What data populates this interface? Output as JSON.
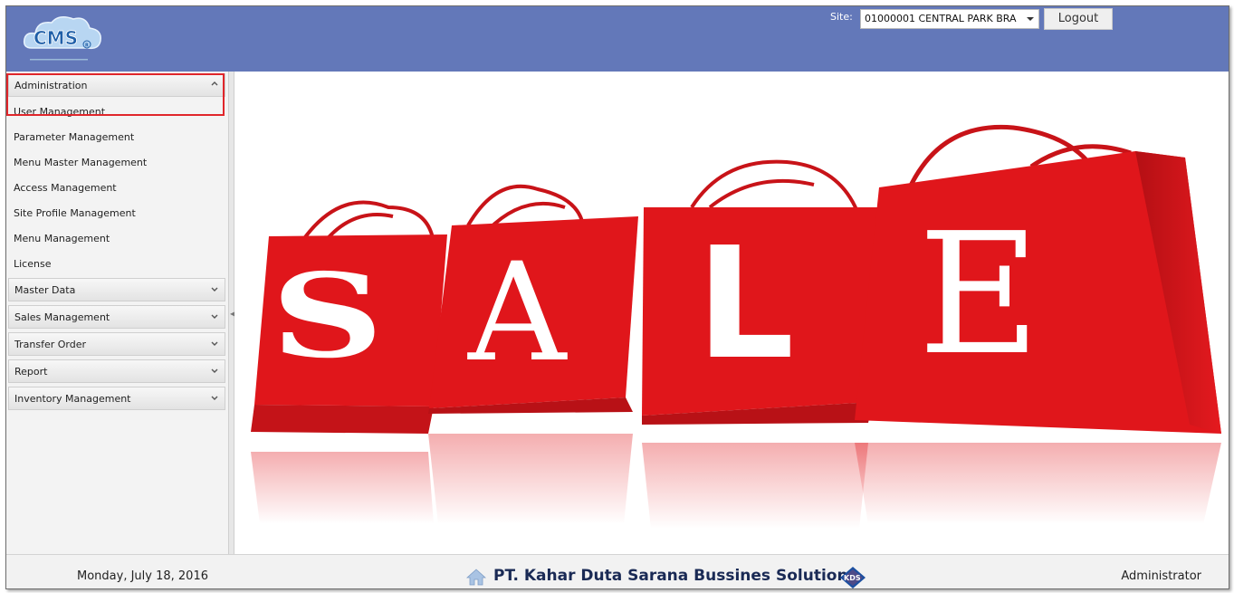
{
  "header": {
    "logo_text": "CMS",
    "logo_registered": "R",
    "site_label": "Site:",
    "site_value": "01000001 CENTRAL PARK BRA",
    "logout_label": "Logout",
    "bg_color": "#6378b9"
  },
  "sidebar": {
    "sections": [
      {
        "label": "Administration",
        "expanded": true,
        "items": [
          "User Management",
          "Parameter Management",
          "Menu Master Management",
          "Access Management",
          "Site Profile Management",
          "Menu Management",
          "License"
        ]
      },
      {
        "label": "Master Data",
        "expanded": false
      },
      {
        "label": "Sales Management",
        "expanded": false
      },
      {
        "label": "Transfer Order",
        "expanded": false
      },
      {
        "label": "Report",
        "expanded": false
      },
      {
        "label": "Inventory Management",
        "expanded": false
      }
    ]
  },
  "banner": {
    "letters": [
      "S",
      "A",
      "L",
      "E"
    ],
    "bag_color": "#e0161b"
  },
  "footer": {
    "date": "Monday, July 18, 2016",
    "company": "PT. Kahar Duta Sarana Bussines Solutions",
    "kds_logo_text": "KDS",
    "user": "Administrator"
  },
  "icons": [
    "cms-logo-icon",
    "dropdown-caret-icon",
    "chevron-up-icon",
    "chevron-down-icon",
    "home-icon",
    "kds-logo-icon"
  ]
}
